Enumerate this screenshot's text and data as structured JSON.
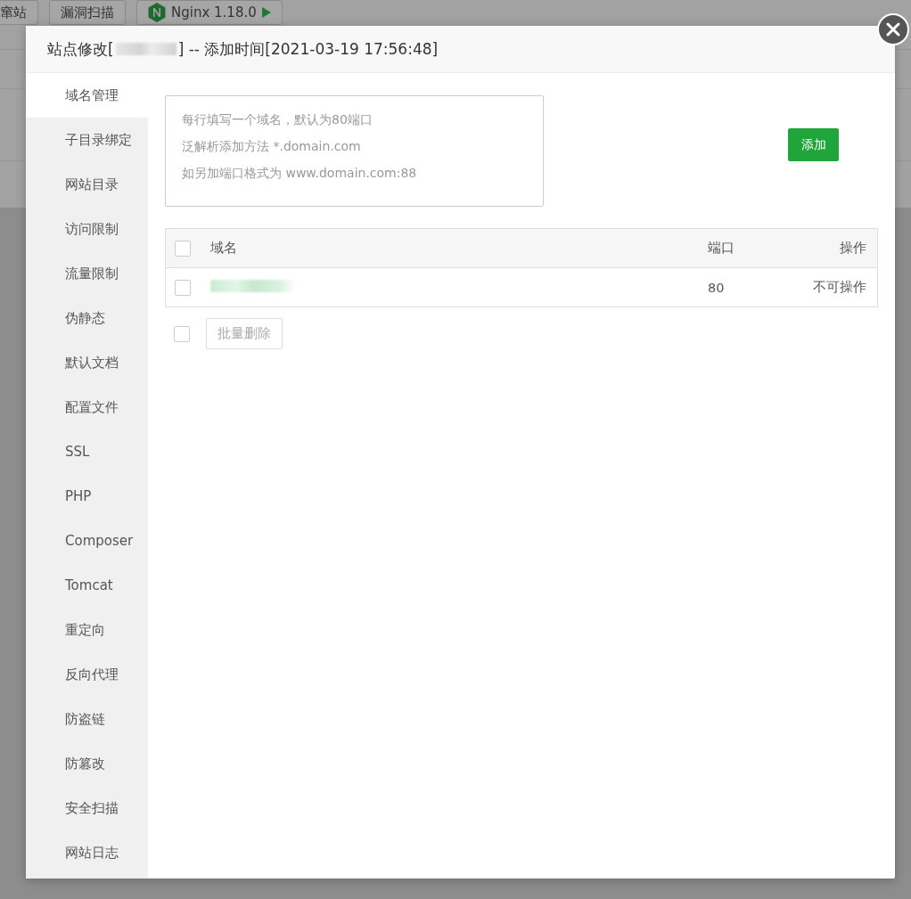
{
  "background_toolbar": {
    "buttons": [
      {
        "label": "窜站",
        "kind": "plain"
      },
      {
        "label": "漏洞扫描",
        "kind": "plain"
      },
      {
        "label": "Nginx 1.18.0",
        "kind": "server"
      }
    ]
  },
  "dialog": {
    "title_prefix": "站点修改[",
    "title_suffix": "] -- 添加时间[2021-03-19 17:56:48]"
  },
  "sidebar": {
    "items": [
      {
        "label": "域名管理",
        "selected": true
      },
      {
        "label": "子目录绑定",
        "selected": false
      },
      {
        "label": "网站目录",
        "selected": false
      },
      {
        "label": "访问限制",
        "selected": false
      },
      {
        "label": "流量限制",
        "selected": false
      },
      {
        "label": "伪静态",
        "selected": false
      },
      {
        "label": "默认文档",
        "selected": false
      },
      {
        "label": "配置文件",
        "selected": false
      },
      {
        "label": "SSL",
        "selected": false
      },
      {
        "label": "PHP",
        "selected": false
      },
      {
        "label": "Composer",
        "selected": false
      },
      {
        "label": "Tomcat",
        "selected": false
      },
      {
        "label": "重定向",
        "selected": false
      },
      {
        "label": "反向代理",
        "selected": false
      },
      {
        "label": "防盗链",
        "selected": false
      },
      {
        "label": "防篡改",
        "selected": false
      },
      {
        "label": "安全扫描",
        "selected": false
      },
      {
        "label": "网站日志",
        "selected": false
      }
    ]
  },
  "domain_input": {
    "placeholder": [
      "每行填写一个域名，默认为80端口",
      "泛解析添加方法 *.domain.com",
      "如另加端口格式为 www.domain.com:88"
    ]
  },
  "add_button": "添加",
  "table": {
    "columns": [
      "域名",
      "端口",
      "操作"
    ],
    "header_checked": false,
    "rows": [
      {
        "checked": false,
        "port": "80",
        "action": "不可操作"
      }
    ]
  },
  "bulk": {
    "checked": false,
    "button": "批量删除"
  }
}
